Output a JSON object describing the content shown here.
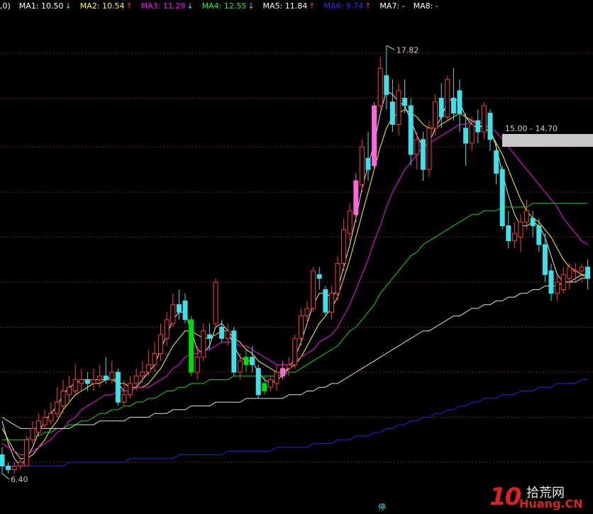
{
  "legend": [
    {
      "text": ",0)",
      "color": "#ffffff"
    },
    {
      "text": "MA1: 10.50",
      "arrow": "↓",
      "color": "#ffffff",
      "arrow_color": "#3fe0e8"
    },
    {
      "text": "MA2: 10.54",
      "arrow": "↑",
      "color": "#ffff00",
      "arrow_color": "#ff3030"
    },
    {
      "text": "MA3: 11.29",
      "arrow": "↓",
      "color": "#ff00ff",
      "arrow_color": "#3fe0e8"
    },
    {
      "text": "MA4: 12.55",
      "arrow": "↓",
      "color": "#00ff00",
      "arrow_color": "#3fe0e8"
    },
    {
      "text": "MA5: 11.84",
      "arrow": "↑",
      "color": "#ffffff",
      "arrow_color": "#ff3030"
    },
    {
      "text": "MA6: 9.74",
      "arrow": "↑",
      "color": "#3030ff",
      "arrow_color": "#ff3030"
    },
    {
      "text": "MA7: -",
      "arrow": "",
      "color": "#ffffff",
      "arrow_color": "#ffffff"
    },
    {
      "text": "MA8: -",
      "arrow": "",
      "color": "#ffffff",
      "arrow_color": "#ffffff"
    }
  ],
  "chart_data": {
    "type": "candlestick",
    "ylim": [
      5.7,
      18.6
    ],
    "gridlines": [
      17.6,
      16.4,
      15.1,
      13.9,
      12.7,
      11.5,
      10.3,
      9.1,
      7.9,
      6.7
    ],
    "annotations": {
      "high": "17.82",
      "low": "6.40",
      "range_label": "15.00 - 14.70"
    },
    "candles": [
      {
        "o": 6.9,
        "c": 6.6,
        "h": 7.1,
        "l": 6.4
      },
      {
        "o": 6.6,
        "c": 6.5,
        "h": 6.7,
        "l": 6.4
      },
      {
        "o": 6.5,
        "c": 6.6,
        "h": 6.7,
        "l": 6.4
      },
      {
        "o": 6.6,
        "c": 6.7,
        "h": 6.8,
        "l": 6.5
      },
      {
        "o": 6.6,
        "c": 7.3,
        "h": 7.4,
        "l": 6.6
      },
      {
        "o": 7.3,
        "c": 7.6,
        "h": 7.8,
        "l": 7.2
      },
      {
        "o": 7.5,
        "c": 7.8,
        "h": 8.0,
        "l": 7.4
      },
      {
        "o": 7.7,
        "c": 7.9,
        "h": 8.1,
        "l": 7.6
      },
      {
        "o": 7.8,
        "c": 8.0,
        "h": 8.3,
        "l": 7.7
      },
      {
        "o": 8.0,
        "c": 8.3,
        "h": 8.7,
        "l": 7.9
      },
      {
        "o": 8.2,
        "c": 8.6,
        "h": 8.9,
        "l": 8.0
      },
      {
        "o": 8.5,
        "c": 8.7,
        "h": 9.0,
        "l": 8.3
      },
      {
        "o": 8.6,
        "c": 8.9,
        "h": 9.3,
        "l": 8.5
      },
      {
        "o": 8.8,
        "c": 8.9,
        "h": 9.2,
        "l": 8.6
      },
      {
        "o": 8.9,
        "c": 8.8,
        "h": 9.1,
        "l": 8.6
      },
      {
        "o": 8.8,
        "c": 8.9,
        "h": 9.2,
        "l": 8.6
      },
      {
        "o": 8.9,
        "c": 9.0,
        "h": 9.3,
        "l": 8.7
      },
      {
        "o": 9.0,
        "c": 8.9,
        "h": 9.5,
        "l": 8.8
      },
      {
        "o": 8.9,
        "c": 9.1,
        "h": 9.4,
        "l": 8.8
      },
      {
        "o": 9.1,
        "c": 8.3,
        "h": 9.2,
        "l": 8.2
      },
      {
        "o": 8.3,
        "c": 8.5,
        "h": 8.9,
        "l": 8.2
      },
      {
        "o": 8.5,
        "c": 8.8,
        "h": 9.0,
        "l": 8.4
      },
      {
        "o": 8.8,
        "c": 9.0,
        "h": 9.2,
        "l": 8.6
      },
      {
        "o": 9.0,
        "c": 9.1,
        "h": 9.4,
        "l": 8.8
      },
      {
        "o": 9.1,
        "c": 9.3,
        "h": 9.7,
        "l": 9.0
      },
      {
        "o": 9.3,
        "c": 9.6,
        "h": 9.9,
        "l": 9.1
      },
      {
        "o": 9.6,
        "c": 10.1,
        "h": 10.4,
        "l": 9.4
      },
      {
        "o": 10.0,
        "c": 10.5,
        "h": 10.7,
        "l": 9.8
      },
      {
        "o": 10.4,
        "c": 10.9,
        "h": 11.2,
        "l": 10.3
      },
      {
        "o": 10.9,
        "c": 10.7,
        "h": 11.3,
        "l": 10.5
      },
      {
        "o": 11.0,
        "c": 10.5,
        "h": 11.2,
        "l": 10.4
      },
      {
        "o": 10.5,
        "c": 9.1,
        "h": 10.6,
        "l": 9.0
      },
      {
        "o": 9.1,
        "c": 9.5,
        "h": 9.8,
        "l": 8.9
      },
      {
        "o": 9.5,
        "c": 10.2,
        "h": 10.4,
        "l": 9.4
      },
      {
        "o": 10.1,
        "c": 10.0,
        "h": 10.4,
        "l": 9.7
      },
      {
        "o": 10.4,
        "c": 11.5,
        "h": 11.6,
        "l": 10.3
      },
      {
        "o": 10.3,
        "c": 10.0,
        "h": 10.5,
        "l": 9.9
      },
      {
        "o": 10.0,
        "c": 10.2,
        "h": 10.4,
        "l": 9.8
      },
      {
        "o": 10.2,
        "c": 9.1,
        "h": 10.3,
        "l": 9.0
      },
      {
        "o": 9.1,
        "c": 9.4,
        "h": 9.6,
        "l": 8.9
      },
      {
        "o": 9.3,
        "c": 9.5,
        "h": 9.7,
        "l": 9.1
      },
      {
        "o": 9.5,
        "c": 9.3,
        "h": 9.8,
        "l": 9.1
      },
      {
        "o": 9.2,
        "c": 8.5,
        "h": 9.3,
        "l": 8.4
      },
      {
        "o": 8.6,
        "c": 8.8,
        "h": 9.0,
        "l": 8.5
      },
      {
        "o": 8.7,
        "c": 8.9,
        "h": 9.0,
        "l": 8.6
      },
      {
        "o": 8.8,
        "c": 9.1,
        "h": 9.3,
        "l": 8.6
      },
      {
        "o": 9.0,
        "c": 9.2,
        "h": 9.4,
        "l": 8.9
      },
      {
        "o": 9.2,
        "c": 9.3,
        "h": 9.5,
        "l": 9.0
      },
      {
        "o": 9.3,
        "c": 10.0,
        "h": 10.1,
        "l": 9.2
      },
      {
        "o": 10.0,
        "c": 10.6,
        "h": 10.8,
        "l": 9.8
      },
      {
        "o": 10.6,
        "c": 10.8,
        "h": 11.0,
        "l": 10.4
      },
      {
        "o": 10.8,
        "c": 11.8,
        "h": 11.9,
        "l": 10.7
      },
      {
        "o": 11.7,
        "c": 11.6,
        "h": 11.9,
        "l": 11.3
      },
      {
        "o": 11.3,
        "c": 10.7,
        "h": 11.4,
        "l": 10.6
      },
      {
        "o": 10.7,
        "c": 11.2,
        "h": 11.4,
        "l": 10.5
      },
      {
        "o": 11.2,
        "c": 12.0,
        "h": 12.2,
        "l": 11.0
      },
      {
        "o": 12.0,
        "c": 12.9,
        "h": 13.2,
        "l": 11.8
      },
      {
        "o": 12.8,
        "c": 13.4,
        "h": 13.6,
        "l": 12.6
      },
      {
        "o": 13.3,
        "c": 14.2,
        "h": 14.4,
        "l": 13.1
      },
      {
        "o": 14.1,
        "c": 15.1,
        "h": 15.3,
        "l": 13.9
      },
      {
        "o": 14.8,
        "c": 14.5,
        "h": 15.5,
        "l": 14.2
      },
      {
        "o": 14.6,
        "c": 16.2,
        "h": 16.3,
        "l": 14.5
      },
      {
        "o": 16.2,
        "c": 17.2,
        "h": 17.5,
        "l": 16.1
      },
      {
        "o": 17.0,
        "c": 16.5,
        "h": 17.8,
        "l": 16.1
      },
      {
        "o": 16.3,
        "c": 15.7,
        "h": 16.9,
        "l": 15.5
      },
      {
        "o": 15.7,
        "c": 16.6,
        "h": 16.8,
        "l": 15.4
      },
      {
        "o": 16.4,
        "c": 16.2,
        "h": 16.9,
        "l": 16.0
      },
      {
        "o": 16.2,
        "c": 14.9,
        "h": 16.4,
        "l": 14.6
      },
      {
        "o": 14.9,
        "c": 15.3,
        "h": 15.5,
        "l": 14.5
      },
      {
        "o": 15.3,
        "c": 14.5,
        "h": 15.5,
        "l": 14.2
      },
      {
        "o": 14.5,
        "c": 15.6,
        "h": 15.8,
        "l": 14.3
      },
      {
        "o": 15.6,
        "c": 16.3,
        "h": 16.5,
        "l": 15.4
      },
      {
        "o": 16.4,
        "c": 15.9,
        "h": 16.8,
        "l": 15.6
      },
      {
        "o": 15.9,
        "c": 16.9,
        "h": 17.0,
        "l": 15.8
      },
      {
        "o": 16.4,
        "c": 16.0,
        "h": 17.2,
        "l": 15.8
      },
      {
        "o": 16.6,
        "c": 16.0,
        "h": 16.9,
        "l": 15.5
      },
      {
        "o": 15.6,
        "c": 15.2,
        "h": 16.0,
        "l": 14.6
      },
      {
        "o": 15.2,
        "c": 15.7,
        "h": 15.9,
        "l": 15.0
      },
      {
        "o": 15.8,
        "c": 15.5,
        "h": 16.1,
        "l": 15.2
      },
      {
        "o": 15.5,
        "c": 16.2,
        "h": 16.3,
        "l": 15.3
      },
      {
        "o": 16.0,
        "c": 15.3,
        "h": 16.1,
        "l": 15.0
      },
      {
        "o": 15.0,
        "c": 14.4,
        "h": 15.2,
        "l": 14.1
      },
      {
        "o": 14.5,
        "c": 13.0,
        "h": 14.6,
        "l": 12.9
      },
      {
        "o": 13.0,
        "c": 12.6,
        "h": 13.4,
        "l": 12.4
      },
      {
        "o": 12.6,
        "c": 12.8,
        "h": 13.1,
        "l": 12.4
      },
      {
        "o": 12.7,
        "c": 13.1,
        "h": 13.3,
        "l": 12.3
      },
      {
        "o": 13.1,
        "c": 13.4,
        "h": 13.7,
        "l": 12.9
      },
      {
        "o": 13.2,
        "c": 13.0,
        "h": 13.4,
        "l": 12.7
      },
      {
        "o": 13.0,
        "c": 12.5,
        "h": 13.2,
        "l": 12.3
      },
      {
        "o": 12.5,
        "c": 11.7,
        "h": 12.8,
        "l": 11.5
      },
      {
        "o": 11.8,
        "c": 11.2,
        "h": 12.0,
        "l": 11.0
      },
      {
        "o": 11.2,
        "c": 11.5,
        "h": 11.7,
        "l": 11.0
      },
      {
        "o": 11.3,
        "c": 11.7,
        "h": 11.9,
        "l": 11.2
      },
      {
        "o": 11.6,
        "c": 11.9,
        "h": 12.0,
        "l": 11.3
      },
      {
        "o": 11.8,
        "c": 11.8,
        "h": 12.0,
        "l": 11.5
      },
      {
        "o": 11.8,
        "c": 11.9,
        "h": 12.0,
        "l": 11.5
      },
      {
        "o": 11.9,
        "c": 11.6,
        "h": 12.1,
        "l": 11.3
      }
    ],
    "overlays": {
      "pink_volume_candles": [
        1,
        61,
        46,
        58,
        72
      ],
      "green_candles": [
        31,
        40,
        43
      ]
    },
    "ma_lines": [
      {
        "name": "MA1",
        "color": "#e8e8e8",
        "values": [
          7.8,
          7.2,
          6.8,
          6.6,
          6.8,
          7.1,
          7.5,
          7.8,
          8.0,
          8.2,
          8.5,
          8.7,
          8.8,
          8.9,
          8.9,
          8.9,
          8.9,
          8.9,
          9.0,
          8.8,
          8.6,
          8.6,
          8.7,
          8.9,
          9.1,
          9.3,
          9.7,
          10.1,
          10.5,
          10.7,
          10.7,
          10.2,
          9.7,
          9.6,
          9.8,
          10.3,
          10.4,
          10.2,
          9.8,
          9.5,
          9.4,
          9.4,
          9.1,
          8.9,
          8.8,
          8.9,
          9.0,
          9.2,
          9.5,
          9.9,
          10.4,
          10.9,
          11.2,
          11.2,
          11.1,
          11.3,
          11.9,
          12.5,
          13.2,
          14.0,
          14.6,
          15.2,
          16.0,
          16.6,
          16.5,
          16.3,
          16.2,
          15.8,
          15.4,
          15.1,
          15.2,
          15.6,
          15.9,
          16.3,
          16.4,
          16.3,
          15.9,
          15.7,
          15.6,
          15.7,
          15.6,
          15.1,
          14.4,
          13.8,
          13.3,
          13.0,
          13.0,
          13.1,
          13.0,
          12.7,
          12.2,
          11.7,
          11.5,
          11.5,
          11.6,
          11.7,
          11.7
        ]
      },
      {
        "name": "MA2",
        "color": "#ffff00",
        "values": [
          7.6,
          7.3,
          7.0,
          6.8,
          6.8,
          6.9,
          7.1,
          7.3,
          7.6,
          7.8,
          8.1,
          8.3,
          8.5,
          8.6,
          8.7,
          8.8,
          8.8,
          8.9,
          8.9,
          8.8,
          8.8,
          8.7,
          8.7,
          8.7,
          8.8,
          9.0,
          9.2,
          9.5,
          9.8,
          10.0,
          10.2,
          10.2,
          10.1,
          10.0,
          10.0,
          10.1,
          10.2,
          10.2,
          10.0,
          9.9,
          9.7,
          9.6,
          9.4,
          9.3,
          9.2,
          9.1,
          9.1,
          9.2,
          9.3,
          9.5,
          9.8,
          10.1,
          10.4,
          10.6,
          10.8,
          11.1,
          11.6,
          12.1,
          12.7,
          13.3,
          13.9,
          14.5,
          15.1,
          15.6,
          15.9,
          16.0,
          16.1,
          16.0,
          15.9,
          15.7,
          15.6,
          15.6,
          15.7,
          15.8,
          15.9,
          16.0,
          15.9,
          15.8,
          15.7,
          15.6,
          15.5,
          15.2,
          14.9,
          14.5,
          14.1,
          13.7,
          13.4,
          13.2,
          13.1,
          12.9,
          12.7,
          12.4,
          12.1,
          11.9,
          11.8,
          11.7,
          11.6
        ]
      },
      {
        "name": "MA3",
        "color": "#ff00ff",
        "values": [
          7.2,
          7.1,
          7.0,
          6.9,
          6.9,
          7.0,
          7.1,
          7.2,
          7.3,
          7.5,
          7.6,
          7.8,
          7.9,
          8.1,
          8.2,
          8.3,
          8.4,
          8.5,
          8.5,
          8.6,
          8.6,
          8.6,
          8.7,
          8.7,
          8.7,
          8.8,
          8.9,
          9.0,
          9.2,
          9.3,
          9.5,
          9.6,
          9.6,
          9.7,
          9.7,
          9.8,
          9.9,
          9.9,
          9.9,
          9.8,
          9.8,
          9.7,
          9.6,
          9.5,
          9.4,
          9.3,
          9.3,
          9.3,
          9.4,
          9.5,
          9.6,
          9.7,
          9.9,
          10.0,
          10.1,
          10.3,
          10.6,
          10.9,
          11.3,
          11.7,
          12.1,
          12.6,
          13.0,
          13.5,
          13.9,
          14.2,
          14.5,
          14.7,
          14.9,
          15.1,
          15.2,
          15.3,
          15.4,
          15.5,
          15.6,
          15.7,
          15.7,
          15.8,
          15.8,
          15.7,
          15.6,
          15.5,
          15.3,
          15.1,
          14.9,
          14.7,
          14.5,
          14.3,
          14.1,
          13.9,
          13.7,
          13.5,
          13.2,
          13.0,
          12.8,
          12.6,
          12.5
        ]
      },
      {
        "name": "MA4",
        "color": "#00dd00",
        "values": [
          7.3,
          7.3,
          7.3,
          7.3,
          7.3,
          7.4,
          7.4,
          7.5,
          7.5,
          7.6,
          7.6,
          7.7,
          7.7,
          7.8,
          7.8,
          7.9,
          8.0,
          8.0,
          8.1,
          8.1,
          8.2,
          8.2,
          8.3,
          8.3,
          8.4,
          8.4,
          8.5,
          8.6,
          8.6,
          8.7,
          8.7,
          8.8,
          8.8,
          8.8,
          8.9,
          8.9,
          8.9,
          8.9,
          9.0,
          9.0,
          9.0,
          9.0,
          9.0,
          9.0,
          9.0,
          9.0,
          9.0,
          9.1,
          9.1,
          9.2,
          9.3,
          9.4,
          9.5,
          9.6,
          9.7,
          9.8,
          10.0,
          10.2,
          10.3,
          10.5,
          10.7,
          10.9,
          11.2,
          11.4,
          11.6,
          11.8,
          12.0,
          12.2,
          12.3,
          12.5,
          12.6,
          12.7,
          12.8,
          12.9,
          13.0,
          13.1,
          13.2,
          13.3,
          13.3,
          13.4,
          13.4,
          13.4,
          13.5,
          13.5,
          13.5,
          13.5,
          13.5,
          13.6,
          13.6,
          13.6,
          13.6,
          13.6,
          13.6,
          13.6,
          13.6,
          13.6,
          13.6
        ]
      },
      {
        "name": "MA5",
        "color": "#e0e0e0",
        "values": [
          7.9,
          7.8,
          7.7,
          7.6,
          7.6,
          7.6,
          7.6,
          7.6,
          7.6,
          7.6,
          7.6,
          7.6,
          7.7,
          7.7,
          7.7,
          7.7,
          7.8,
          7.8,
          7.8,
          7.8,
          7.8,
          7.9,
          7.9,
          7.9,
          7.9,
          8.0,
          8.0,
          8.0,
          8.1,
          8.1,
          8.1,
          8.2,
          8.2,
          8.2,
          8.2,
          8.3,
          8.3,
          8.3,
          8.3,
          8.3,
          8.4,
          8.4,
          8.4,
          8.4,
          8.4,
          8.4,
          8.4,
          8.5,
          8.5,
          8.5,
          8.6,
          8.6,
          8.7,
          8.7,
          8.8,
          8.8,
          8.9,
          9.0,
          9.1,
          9.2,
          9.3,
          9.4,
          9.5,
          9.6,
          9.7,
          9.8,
          9.9,
          10.0,
          10.1,
          10.2,
          10.2,
          10.3,
          10.4,
          10.5,
          10.6,
          10.6,
          10.7,
          10.8,
          10.8,
          10.9,
          10.9,
          11.0,
          11.0,
          11.1,
          11.1,
          11.2,
          11.2,
          11.3,
          11.3,
          11.4,
          11.4,
          11.4,
          11.5,
          11.5,
          11.5,
          11.6,
          11.6
        ]
      },
      {
        "name": "MA6",
        "color": "#2020ff",
        "values": [
          6.6,
          6.6,
          6.6,
          6.6,
          6.6,
          6.6,
          6.6,
          6.6,
          6.6,
          6.6,
          6.6,
          6.7,
          6.7,
          6.7,
          6.7,
          6.7,
          6.7,
          6.7,
          6.7,
          6.7,
          6.7,
          6.8,
          6.8,
          6.8,
          6.8,
          6.8,
          6.8,
          6.8,
          6.8,
          6.9,
          6.9,
          6.9,
          6.9,
          6.9,
          6.9,
          6.9,
          6.9,
          7.0,
          7.0,
          7.0,
          7.0,
          7.0,
          7.0,
          7.0,
          7.0,
          7.1,
          7.1,
          7.1,
          7.1,
          7.1,
          7.1,
          7.2,
          7.2,
          7.2,
          7.2,
          7.3,
          7.3,
          7.3,
          7.4,
          7.4,
          7.4,
          7.5,
          7.5,
          7.6,
          7.6,
          7.7,
          7.7,
          7.8,
          7.8,
          7.9,
          7.9,
          8.0,
          8.0,
          8.1,
          8.1,
          8.2,
          8.2,
          8.3,
          8.3,
          8.4,
          8.4,
          8.4,
          8.5,
          8.5,
          8.5,
          8.6,
          8.6,
          8.6,
          8.7,
          8.7,
          8.7,
          8.8,
          8.8,
          8.8,
          8.8,
          8.9,
          8.9
        ]
      }
    ]
  },
  "watermark": {
    "number": "10",
    "cn": "拾荒网",
    "en": "Huang.CN"
  },
  "bottom_glyph": "停"
}
